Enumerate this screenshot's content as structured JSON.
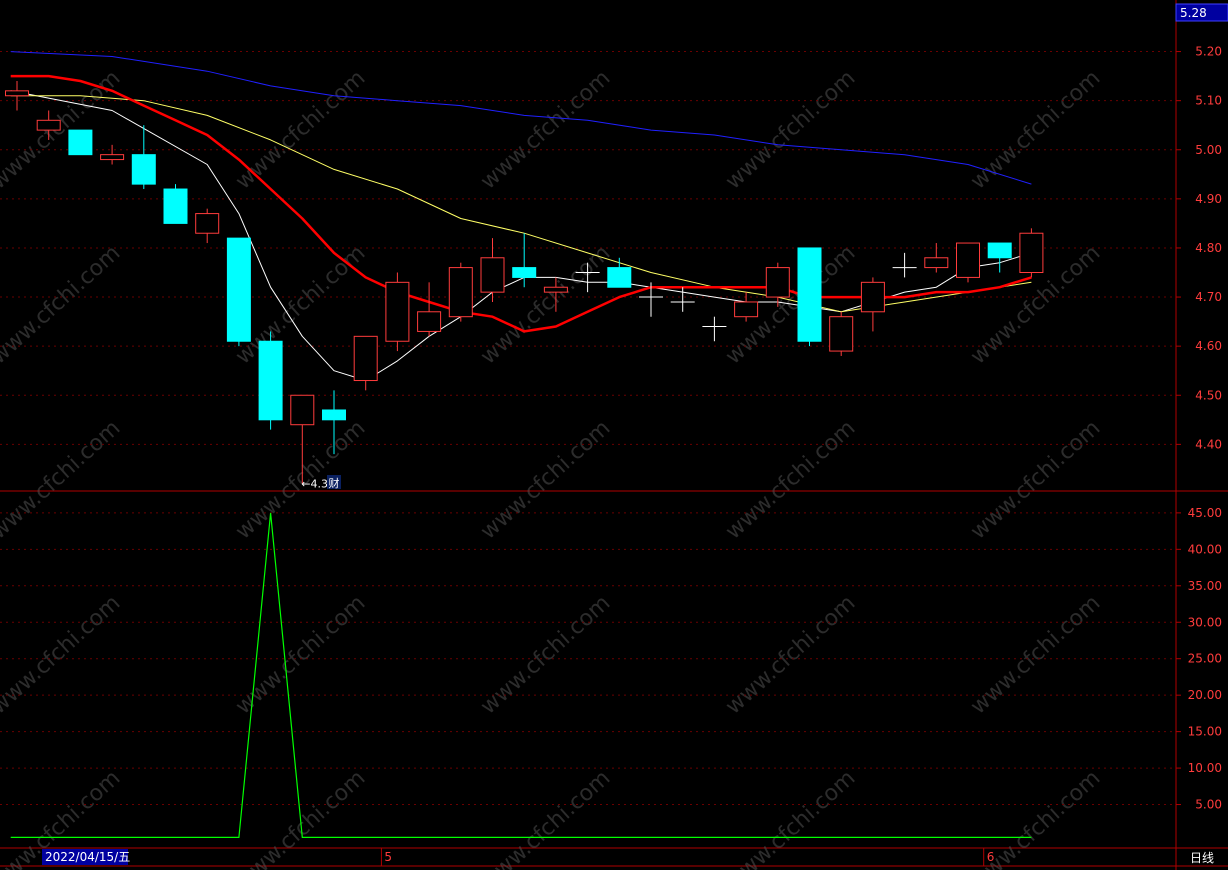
{
  "header": {
    "last_price": "5.28",
    "period": "日线",
    "date_cursor": "2022/04/15/五"
  },
  "colors": {
    "up": "#ff3c3c",
    "down": "#00ffff",
    "flat": "#ffffff",
    "ma5": "#ffffff",
    "ma10": "#ffff66",
    "ma20": "#ff0000",
    "ma60": "#2020ff",
    "lower_line": "#00ff00",
    "axis": "#b00000",
    "label": "#ff3c3c",
    "watermark": "#505050"
  },
  "watermark": "www.cfchi.com",
  "chart_data": {
    "type": "candlestick",
    "price_axis": {
      "ylim": [
        4.305,
        5.305
      ],
      "ticks": [
        "5.20",
        "5.10",
        "5.00",
        "4.90",
        "4.80",
        "4.70",
        "4.60",
        "4.50",
        "4.40"
      ]
    },
    "indicator_axis": {
      "ylim": [
        0,
        48
      ],
      "ticks": [
        "45.00",
        "40.00",
        "35.00",
        "30.00",
        "25.00",
        "20.00",
        "15.00",
        "10.00",
        "5.00"
      ]
    },
    "x_labels": [
      {
        "index": 12,
        "text": "5"
      },
      {
        "index": 31,
        "text": "6"
      }
    ],
    "min_marker": {
      "index": 9,
      "text": "←4.32"
    },
    "event_marker": {
      "index": 10,
      "text": "财"
    },
    "candles": [
      {
        "o": 5.11,
        "c": 5.12,
        "h": 5.14,
        "l": 5.08
      },
      {
        "o": 5.04,
        "c": 5.06,
        "h": 5.08,
        "l": 5.02
      },
      {
        "o": 5.04,
        "c": 4.99,
        "h": 5.04,
        "l": 4.99
      },
      {
        "o": 4.98,
        "c": 4.99,
        "h": 5.01,
        "l": 4.97
      },
      {
        "o": 4.99,
        "c": 4.93,
        "h": 5.05,
        "l": 4.92
      },
      {
        "o": 4.92,
        "c": 4.85,
        "h": 4.93,
        "l": 4.85
      },
      {
        "o": 4.83,
        "c": 4.87,
        "h": 4.88,
        "l": 4.81
      },
      {
        "o": 4.82,
        "c": 4.61,
        "h": 4.82,
        "l": 4.6
      },
      {
        "o": 4.61,
        "c": 4.45,
        "h": 4.63,
        "l": 4.43
      },
      {
        "o": 4.44,
        "c": 4.5,
        "h": 4.5,
        "l": 4.32
      },
      {
        "o": 4.47,
        "c": 4.45,
        "h": 4.51,
        "l": 4.38
      },
      {
        "o": 4.53,
        "c": 4.62,
        "h": 4.62,
        "l": 4.51
      },
      {
        "o": 4.61,
        "c": 4.73,
        "h": 4.75,
        "l": 4.59
      },
      {
        "o": 4.63,
        "c": 4.67,
        "h": 4.73,
        "l": 4.62
      },
      {
        "o": 4.66,
        "c": 4.76,
        "h": 4.77,
        "l": 4.65
      },
      {
        "o": 4.71,
        "c": 4.78,
        "h": 4.82,
        "l": 4.69
      },
      {
        "o": 4.76,
        "c": 4.74,
        "h": 4.83,
        "l": 4.72
      },
      {
        "o": 4.71,
        "c": 4.72,
        "h": 4.74,
        "l": 4.67
      },
      {
        "o": 4.75,
        "c": 4.75,
        "h": 4.77,
        "l": 4.71
      },
      {
        "o": 4.76,
        "c": 4.72,
        "h": 4.78,
        "l": 4.72
      },
      {
        "o": 4.7,
        "c": 4.7,
        "h": 4.73,
        "l": 4.66
      },
      {
        "o": 4.69,
        "c": 4.69,
        "h": 4.72,
        "l": 4.67
      },
      {
        "o": 4.64,
        "c": 4.64,
        "h": 4.66,
        "l": 4.61
      },
      {
        "o": 4.66,
        "c": 4.69,
        "h": 4.71,
        "l": 4.65
      },
      {
        "o": 4.7,
        "c": 4.76,
        "h": 4.77,
        "l": 4.68
      },
      {
        "o": 4.8,
        "c": 4.61,
        "h": 4.8,
        "l": 4.6
      },
      {
        "o": 4.59,
        "c": 4.66,
        "h": 4.67,
        "l": 4.58
      },
      {
        "o": 4.67,
        "c": 4.73,
        "h": 4.74,
        "l": 4.63
      },
      {
        "o": 4.76,
        "c": 4.76,
        "h": 4.79,
        "l": 4.74
      },
      {
        "o": 4.76,
        "c": 4.78,
        "h": 4.81,
        "l": 4.75
      },
      {
        "o": 4.74,
        "c": 4.81,
        "h": 4.81,
        "l": 4.73
      },
      {
        "o": 4.81,
        "c": 4.78,
        "h": 4.81,
        "l": 4.75
      },
      {
        "o": 4.75,
        "c": 4.83,
        "h": 4.84,
        "l": 4.74
      }
    ],
    "ma_series": [
      {
        "key": "ma5",
        "width": 1,
        "points": [
          [
            -0.2,
            5.12
          ],
          [
            3,
            5.08
          ],
          [
            6,
            4.97
          ],
          [
            7,
            4.87
          ],
          [
            8,
            4.72
          ],
          [
            9,
            4.62
          ],
          [
            10,
            4.55
          ],
          [
            11,
            4.53
          ],
          [
            12,
            4.57
          ],
          [
            13,
            4.62
          ],
          [
            14,
            4.66
          ],
          [
            15,
            4.71
          ],
          [
            16,
            4.74
          ],
          [
            17,
            4.74
          ],
          [
            18,
            4.73
          ],
          [
            19,
            4.73
          ],
          [
            20,
            4.72
          ],
          [
            21,
            4.71
          ],
          [
            22,
            4.7
          ],
          [
            23,
            4.69
          ],
          [
            24,
            4.69
          ],
          [
            25,
            4.68
          ],
          [
            26,
            4.67
          ],
          [
            27,
            4.69
          ],
          [
            28,
            4.71
          ],
          [
            29,
            4.72
          ],
          [
            30,
            4.76
          ],
          [
            31,
            4.77
          ],
          [
            32,
            4.79
          ]
        ]
      },
      {
        "key": "ma10",
        "width": 1,
        "points": [
          [
            -0.2,
            5.11
          ],
          [
            2,
            5.11
          ],
          [
            4,
            5.1
          ],
          [
            6,
            5.07
          ],
          [
            8,
            5.02
          ],
          [
            10,
            4.96
          ],
          [
            12,
            4.92
          ],
          [
            14,
            4.86
          ],
          [
            16,
            4.83
          ],
          [
            18,
            4.79
          ],
          [
            20,
            4.75
          ],
          [
            22,
            4.72
          ],
          [
            24,
            4.7
          ],
          [
            26,
            4.67
          ],
          [
            28,
            4.69
          ],
          [
            30,
            4.71
          ],
          [
            32,
            4.73
          ]
        ]
      },
      {
        "key": "ma20",
        "width": 2.5,
        "points": [
          [
            -0.2,
            5.15
          ],
          [
            1,
            5.15
          ],
          [
            2,
            5.14
          ],
          [
            3,
            5.12
          ],
          [
            4,
            5.09
          ],
          [
            5,
            5.06
          ],
          [
            6,
            5.03
          ],
          [
            7,
            4.98
          ],
          [
            8,
            4.92
          ],
          [
            9,
            4.86
          ],
          [
            10,
            4.79
          ],
          [
            11,
            4.74
          ],
          [
            12,
            4.71
          ],
          [
            13,
            4.69
          ],
          [
            14,
            4.67
          ],
          [
            15,
            4.66
          ],
          [
            16,
            4.63
          ],
          [
            17,
            4.64
          ],
          [
            18,
            4.67
          ],
          [
            19,
            4.7
          ],
          [
            20,
            4.72
          ],
          [
            21,
            4.72
          ],
          [
            22,
            4.72
          ],
          [
            23,
            4.72
          ],
          [
            24,
            4.72
          ],
          [
            25,
            4.7
          ],
          [
            26,
            4.7
          ],
          [
            27,
            4.7
          ],
          [
            28,
            4.7
          ],
          [
            29,
            4.71
          ],
          [
            30,
            4.71
          ],
          [
            31,
            4.72
          ],
          [
            32,
            4.74
          ]
        ]
      },
      {
        "key": "ma60",
        "width": 1,
        "points": [
          [
            -0.2,
            5.2
          ],
          [
            3,
            5.19
          ],
          [
            6,
            5.16
          ],
          [
            8,
            5.13
          ],
          [
            10,
            5.11
          ],
          [
            12,
            5.1
          ],
          [
            14,
            5.09
          ],
          [
            16,
            5.07
          ],
          [
            18,
            5.06
          ],
          [
            20,
            5.04
          ],
          [
            22,
            5.03
          ],
          [
            24,
            5.01
          ],
          [
            26,
            5.0
          ],
          [
            28,
            4.99
          ],
          [
            30,
            4.97
          ],
          [
            32,
            4.93
          ]
        ]
      }
    ],
    "indicator": {
      "key": "lower_line",
      "points": [
        [
          -0.2,
          0.5
        ],
        [
          7,
          0.5
        ],
        [
          8,
          45
        ],
        [
          9,
          0.5
        ],
        [
          32,
          0.5
        ]
      ]
    }
  }
}
